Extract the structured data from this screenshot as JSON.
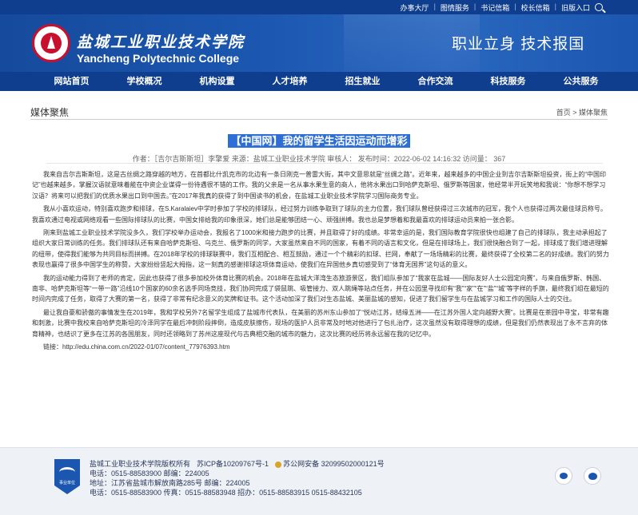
{
  "top_links": [
    "办事大厅",
    "图情服务",
    "书记信箱",
    "校长信箱",
    "旧版入口"
  ],
  "school": {
    "name_cn": "盐城工业职业技术学院",
    "name_en": "Yancheng Polytechnic College",
    "slogan": "职业立身  技术报国"
  },
  "nav": [
    "网站首页",
    "学校概况",
    "机构设置",
    "人才培养",
    "招生就业",
    "合作交流",
    "科技服务",
    "公共服务"
  ],
  "section_title": "媒体聚焦",
  "breadcrumb": "首页 > 媒体聚焦",
  "article": {
    "title": "【中国网】我的留学生活因运动而增彩",
    "meta": "作者：［吉尔吉斯斯坦］李擎爱   来源：盐城工业职业技术学院   审核人：   发布时间：2022-06-02 14:16:32   访问量：  367",
    "paragraphs": [
      "我来自吉尔吉斯斯坦，这是古丝绸之路穿越的地方，在首都比什凯克市的北边有一条日刚克一普雷大街，其中文意思就是“丝绸之路”。近年来，越来越多的中国企业到吉尔吉斯斯坦投资，街上的“中国印记”也越来越多，掌握汉语就意味着能在中资企业谋得一份待遇很不错的工作。我的父亲是一名从事水果生意的商人，他将水果出口到哈萨克斯坦、俄罗斯等国家，他经常半开玩笑地和我说：“你想不想学习汉语？将来可以把我们的优质水果出口到中国去。”在2017年我真的获得了到中国读书的机会，在盐城工业职业技术学院学习国际商务专业。",
      "我从小喜欢运动，特别喜欢跑步和排球，在S.Karalaiev中学时参加了学校的排球队，经过努力训练争取到了球队的主力位置，我们球队曾经获得过三次城市的冠军，我个人也获得过两次最佳球员称号。我喜欢通过电视或网络观看一些国际排球队的比赛，中国女排给我的印象很深，她们总是能够团结一心、顽强拼搏。我也总是梦想着和我最喜欢的排球运动员来拍一张合影。",
      "刚来到盐城工业职业技术学院没多久，我们学校举办运动会，我报名了1000米和接力跑步的比赛，并且取得了好的成绩。非常幸运的是，我们国际教育学院很快也组建了自己的排球队，我主动承担起了组织大家日常训练的任务。我们排球队还有来自哈萨克斯坦、乌克兰、俄罗斯的同学，大家虽然来自不同的国家，有着不同的语言和文化，但是在排球场上，我们很快融合到了一起，排球成了我们增进理解的纽带，使得我们能够为共同目标而拼搏。在2018年学校的排球联赛中，我们互相配合、相互鼓励，通过一个个精彩的扣球、拦网，奉献了一场场精彩的比赛，最终获得了全校第二名的好成绩。我们的努力表现也赢得了很多中国学生的称赞，大家纷纷竖起大拇指，这一刻真的感谢排球这项体育运动，使我们在异国他乡真切感受到了“体育无国界”这句话的意义。",
      "我的运动能力得到了老师的肯定，因此也获得了很多参加校外体育比赛的机会。2018年在盐城大洋湾生态旅游景区，我们组队参加了“我家在盐城——国际友好人士公园定向赛”，与来自俄罗斯、韩国、南非、哈萨克斯坦等“一带一路”沿线10个国家的60余名选手同场竞技，我们协同完成了袋鼠跳、吸管接力、双人跳绳等站点任务，并在公园里寻找印有“我”“家”“在”“盐”“城”等字样的手旗，最终我们组在最短的时间内完成了任务，取得了大赛的第一名，获得了非常有纪念意义的奖牌和证书。这个活动加深了我们对生态盐城、美丽盐城的感知，促进了我们留学生与在盐城学习和工作的国际人士的交往。",
      "最让我自豪和骄傲的事情发生在2019年，我和学校另外7名留学生组成了盐城市代表队，在美丽的苏州东山参加了“悦动江苏，结缘五洲——在江苏外国人定向越野大赛”。比赛是在茶园中寻宝，非常有趣和刺激，比赛中我校来自哈萨克斯坦的冷泽同学在最后冲刺阶段摔倒，造成皮肤擦伤，现场的医护人员非常及时地对他进行了包扎治疗，这次虽然没有取得理想的成绩，但是我们仍然表现出了永不言弃的体育精神，也结识了更多在江苏的各国朋友，同时还领略到了苏州这座现代与古典相交融的城市的魅力，这次比赛的经历将永远留在我的记忆中。"
    ],
    "link": "链接：http://edu.china.com.cn/2022-01/07/content_77976393.htm"
  },
  "footer": {
    "copyright": "盐城工业职业技术学院版权所有",
    "icp": "苏ICP备10209767号-1",
    "police": "苏公网安备 32099502000121号",
    "phone": "电话：0515-88583900   邮编：224005",
    "address": "地址：江苏省盐城市解放南路285号   邮编：224005",
    "contact": "电话：0515-88583900  传真：0515-88583948  招办：0515-88583915 0515-88432105",
    "badge": "事业单位"
  }
}
